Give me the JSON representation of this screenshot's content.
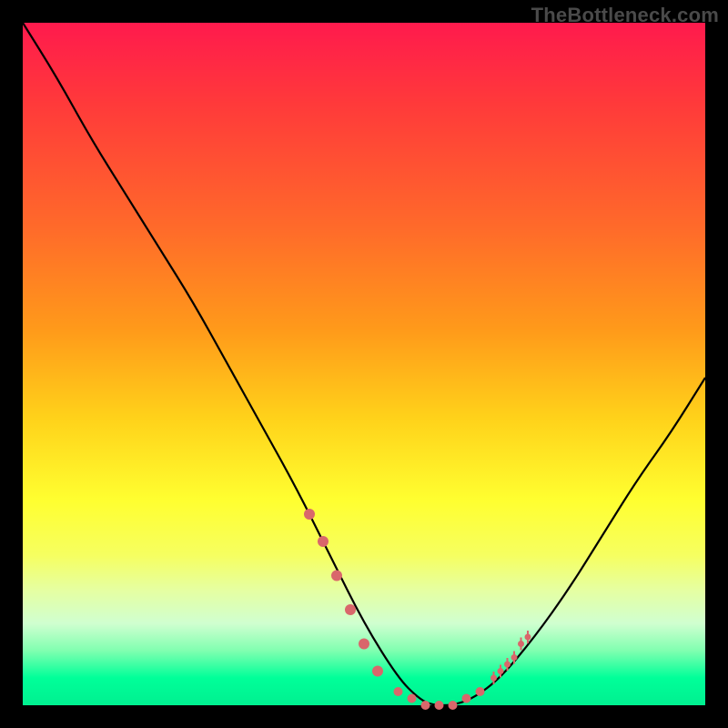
{
  "watermark": "TheBottleneck.com",
  "colors": {
    "background": "#000000",
    "gradient_top": "#ff1a4d",
    "gradient_bottom": "#00f090",
    "curve": "#000000",
    "marker": "#d9676b"
  },
  "chart_data": {
    "type": "line",
    "title": "",
    "xlabel": "",
    "ylabel": "",
    "xlim": [
      0,
      100
    ],
    "ylim": [
      0,
      100
    ],
    "grid": false,
    "legend": false,
    "series": [
      {
        "name": "bottleneck-curve",
        "x": [
          0,
          5,
          10,
          15,
          20,
          25,
          30,
          35,
          40,
          45,
          50,
          55,
          58,
          60,
          63,
          66,
          70,
          75,
          80,
          85,
          90,
          95,
          100
        ],
        "values": [
          100,
          92,
          83,
          75,
          67,
          59,
          50,
          41,
          32,
          22,
          12,
          4,
          1,
          0,
          0,
          1,
          4,
          10,
          17,
          25,
          33,
          40,
          48
        ]
      }
    ],
    "markers_left": {
      "comment": "salmon dots on descending branch near bottom",
      "x": [
        42,
        44,
        46,
        48,
        50,
        52
      ],
      "values": [
        28,
        24,
        19,
        14,
        9,
        5
      ]
    },
    "markers_bottom": {
      "comment": "salmon dots/dashes along the valley floor",
      "x": [
        55,
        57,
        59,
        61,
        63,
        65,
        67
      ],
      "values": [
        2,
        1,
        0,
        0,
        0,
        1,
        2
      ]
    },
    "markers_right_ticks": {
      "comment": "short salmon tick marks on ascending branch",
      "x": [
        69,
        70,
        71,
        72,
        73,
        74
      ],
      "values": [
        4,
        5,
        6,
        7,
        9,
        10
      ]
    }
  }
}
